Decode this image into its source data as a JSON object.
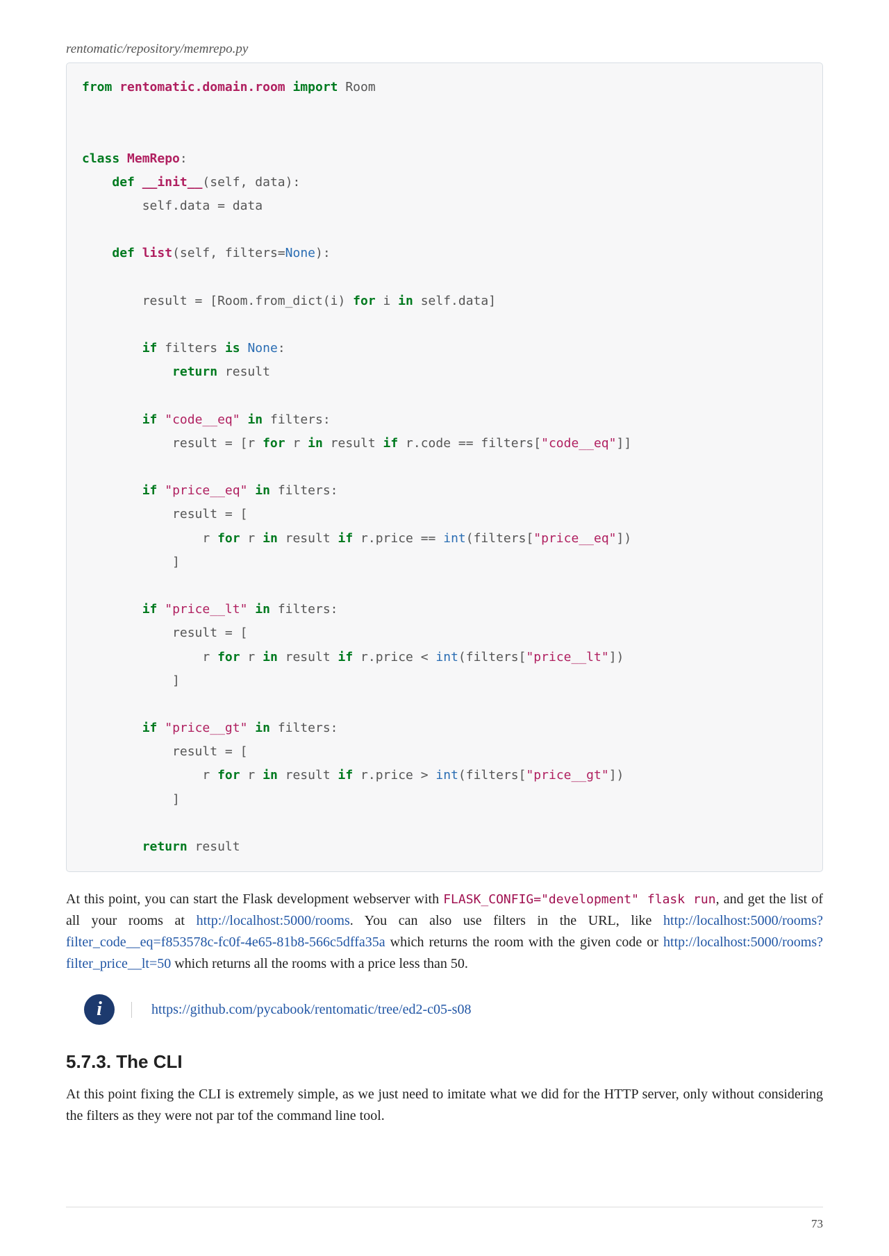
{
  "caption": "rentomatic/repository/memrepo.py",
  "code": {
    "l1_from": "from",
    "l1_module": "rentomatic.domain.room",
    "l1_import": "import",
    "l1_name": "Room",
    "l2_class": "class",
    "l2_clsname": "MemRepo",
    "l3_def": "def",
    "l3_fn": "__init__",
    "l3_params": "(self, data):",
    "l4": "        self.data = data",
    "l5_def": "def",
    "l5_fn": "list",
    "l5_params_a": "(self, filters=",
    "l5_none": "None",
    "l5_params_b": "):",
    "l6_a": "        result = [Room.from_dict(i) ",
    "l6_for": "for",
    "l6_b": " i ",
    "l6_in": "in",
    "l6_c": " self.data]",
    "l7_if": "if",
    "l7_a": " filters ",
    "l7_is": "is",
    "l7_b": " ",
    "l7_none": "None",
    "l7_c": ":",
    "l8_return": "return",
    "l8_b": " result",
    "if_kw": "if",
    "in_kw": "in",
    "for_kw": "for",
    "codeeq_str": "\"code__eq\"",
    "priceeq_str": "\"price__eq\"",
    "pricelt_str": "\"price__lt\"",
    "pricegt_str": "\"price__gt\"",
    "in_filters": " filters:",
    "result_open": "            result = [",
    "result_open_inline_a": "            result = [r ",
    "result_open_inline_b": " r ",
    "result_open_inline_c": " result ",
    "result_open_inline_d": " r.code == filters[",
    "result_open_inline_e": "]]",
    "rfor_a": "                r ",
    "rfor_b": " r ",
    "rfor_c": " result ",
    "eq_tail_a": " r.price == ",
    "lt_tail_a": " r.price < ",
    "gt_tail_a": " r.price > ",
    "int_fn": "int",
    "filters_open": "(filters[",
    "filters_close": "])",
    "close_bracket": "            ]",
    "ret_return": "return",
    "ret_b": " result"
  },
  "para1": {
    "t1": "At this point, you can start the Flask development webserver with ",
    "code1": "FLASK_CONFIG=\"development\" flask run",
    "t2": ", and get the list of all your rooms at ",
    "link1": "http://localhost:5000/rooms",
    "t3": ". You can also use filters in the URL, like ",
    "link2": "http://localhost:5000/rooms?filter_code__eq=f853578c-fc0f-4e65-81b8-566c5dffa35a",
    "t4": " which returns the room with the given code or ",
    "link3": "http://localhost:5000/rooms?filter_price__lt=50",
    "t5": " which returns all the rooms with a price less than 50."
  },
  "admonition": {
    "icon_label": "i",
    "link": "https://github.com/pycabook/rentomatic/tree/ed2-c05-s08"
  },
  "section": {
    "heading": "5.7.3. The CLI",
    "body": "At this point fixing the CLI is extremely simple, as we just need to imitate what we did for the HTTP server, only without considering the filters as they were not par tof the command line tool."
  },
  "page_number": "73"
}
